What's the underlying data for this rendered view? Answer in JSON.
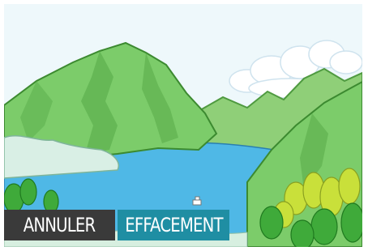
{
  "menu": {
    "cancel_label": "ANNULER",
    "erase_label": "EFFACEMENT"
  },
  "colors": {
    "cancel_bg": "#3a3a3a",
    "erase_bg": "#1f8ea3",
    "sky": "#eaf6fb",
    "lake": "#4fb8e6",
    "mountain": "#7ccc6a"
  }
}
